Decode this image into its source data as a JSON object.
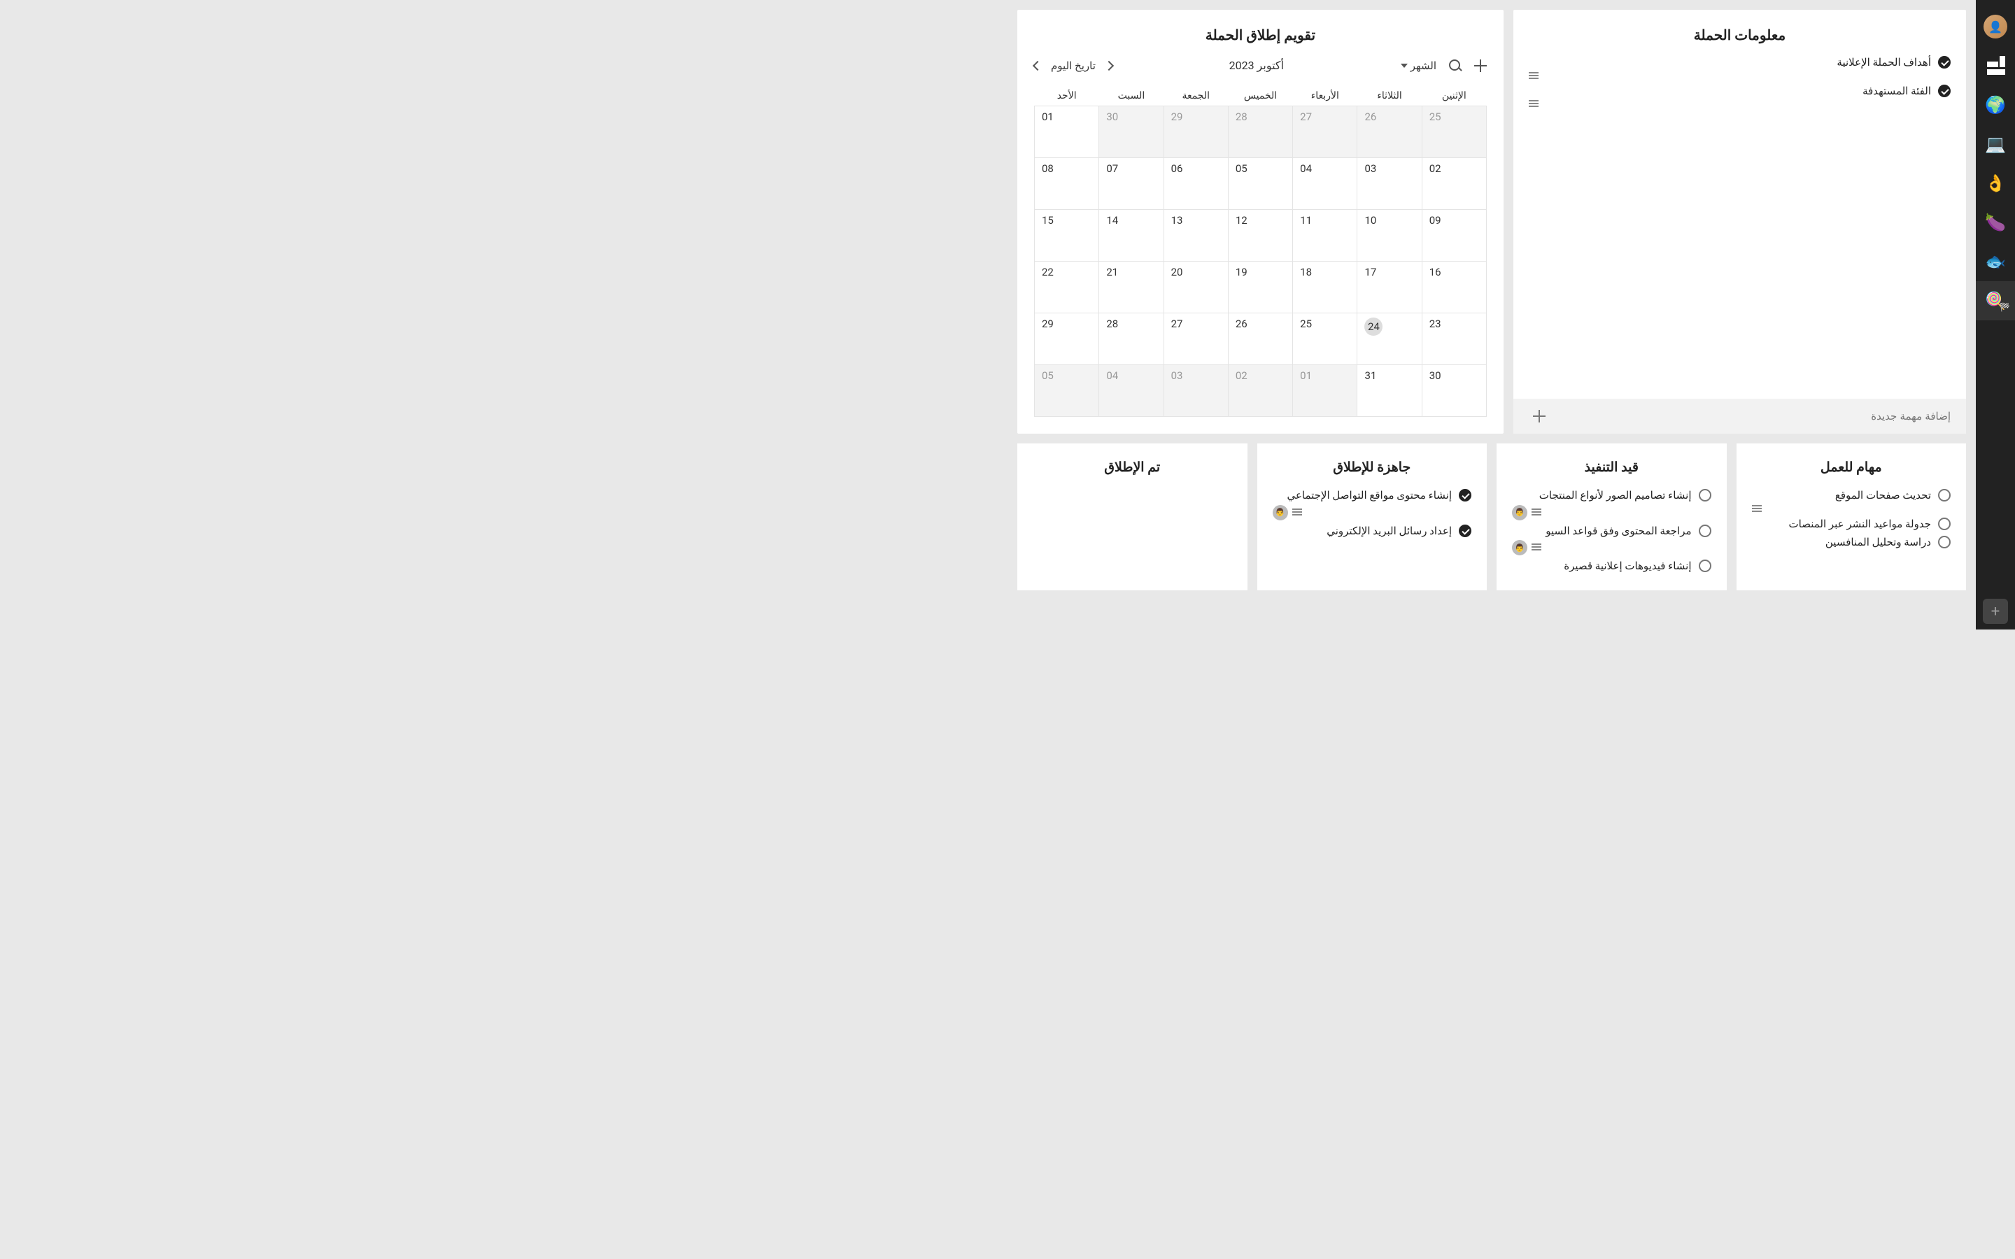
{
  "sidebar": {
    "items": [
      {
        "name": "avatar",
        "icon": "👤"
      },
      {
        "name": "logo",
        "icon": "logo"
      },
      {
        "name": "globe",
        "icon": "🌍"
      },
      {
        "name": "laptop",
        "icon": "💻"
      },
      {
        "name": "ok",
        "icon": "👌"
      },
      {
        "name": "eggplant",
        "icon": "🍆"
      },
      {
        "name": "fish",
        "icon": "🐟"
      },
      {
        "name": "candy",
        "icon": "🍭",
        "active": true
      }
    ],
    "add_label": "+"
  },
  "info_panel": {
    "title": "معلومات الحملة",
    "tasks": [
      {
        "title": "أهداف الحملة الإعلانية",
        "done": true,
        "has_notes": true
      },
      {
        "title": "الفئة المستهدفة",
        "done": true,
        "has_notes": true
      }
    ],
    "add_placeholder": "إضافة مهمة جديدة"
  },
  "calendar": {
    "title": "تقويم إطلاق الحملة",
    "view_label": "الشهر",
    "month_label": "أكتوبر 2023",
    "today_label": "تاريخ اليوم",
    "weekdays": [
      "الإثنين",
      "الثلاثاء",
      "الأربعاء",
      "الخميس",
      "الجمعة",
      "السبت",
      "الأحد"
    ],
    "weeks": [
      [
        {
          "d": "25",
          "o": true
        },
        {
          "d": "26",
          "o": true
        },
        {
          "d": "27",
          "o": true
        },
        {
          "d": "28",
          "o": true
        },
        {
          "d": "29",
          "o": true
        },
        {
          "d": "30",
          "o": true
        },
        {
          "d": "01"
        }
      ],
      [
        {
          "d": "02"
        },
        {
          "d": "03"
        },
        {
          "d": "04"
        },
        {
          "d": "05"
        },
        {
          "d": "06"
        },
        {
          "d": "07"
        },
        {
          "d": "08"
        }
      ],
      [
        {
          "d": "09"
        },
        {
          "d": "10"
        },
        {
          "d": "11"
        },
        {
          "d": "12"
        },
        {
          "d": "13"
        },
        {
          "d": "14"
        },
        {
          "d": "15"
        }
      ],
      [
        {
          "d": "16"
        },
        {
          "d": "17"
        },
        {
          "d": "18"
        },
        {
          "d": "19"
        },
        {
          "d": "20"
        },
        {
          "d": "21"
        },
        {
          "d": "22"
        }
      ],
      [
        {
          "d": "23"
        },
        {
          "d": "24",
          "today": true
        },
        {
          "d": "25"
        },
        {
          "d": "26"
        },
        {
          "d": "27"
        },
        {
          "d": "28"
        },
        {
          "d": "29"
        }
      ],
      [
        {
          "d": "30"
        },
        {
          "d": "31"
        },
        {
          "d": "01",
          "o": true
        },
        {
          "d": "02",
          "o": true
        },
        {
          "d": "03",
          "o": true
        },
        {
          "d": "04",
          "o": true
        },
        {
          "d": "05",
          "o": true
        }
      ]
    ]
  },
  "columns": [
    {
      "title": "مهام للعمل",
      "tasks": [
        {
          "title": "تحديث صفحات الموقع",
          "done": false,
          "has_notes": true
        },
        {
          "title": "جدولة مواعيد النشر عبر المنصات",
          "done": false
        },
        {
          "title": "دراسة وتحليل المنافسين",
          "done": false
        }
      ]
    },
    {
      "title": "قيد التنفيذ",
      "tasks": [
        {
          "title": "إنشاء تصاميم الصور لأنواع المنتجات",
          "done": false,
          "has_notes": true,
          "avatar": "👨"
        },
        {
          "title": "مراجعة المحتوى وفق قواعد السيو",
          "done": false,
          "has_notes": true,
          "avatar": "👨"
        },
        {
          "title": "إنشاء فيديوهات إعلانية قصيرة",
          "done": false
        }
      ]
    },
    {
      "title": "جاهزة للإطلاق",
      "tasks": [
        {
          "title": "إنشاء محتوى مواقع التواصل الإجتماعي",
          "done": true,
          "has_notes": true,
          "avatar": "👨"
        },
        {
          "title": "إعداد رسائل البريد الإلكتروني",
          "done": true
        }
      ]
    },
    {
      "title": "تم الإطلاق",
      "tasks": []
    }
  ]
}
